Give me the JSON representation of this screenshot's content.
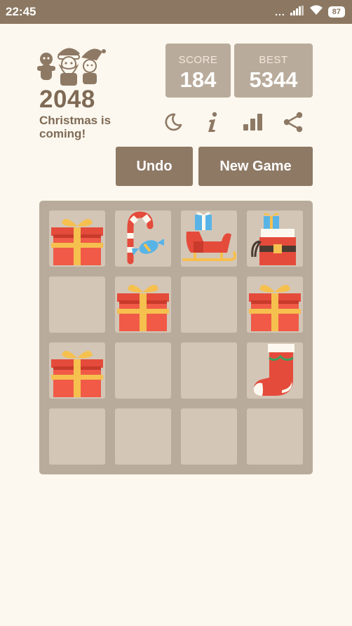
{
  "status_bar": {
    "time": "22:45",
    "dots": "...",
    "battery": "87",
    "icons": [
      "signal-icon",
      "wifi-icon",
      "battery-icon"
    ]
  },
  "header": {
    "title": "2048",
    "subtitle": "Christmas is coming!",
    "logo": "santa-elf-gingerbread-logo"
  },
  "scores": {
    "score_label": "SCORE",
    "score_value": "184",
    "best_label": "BEST",
    "best_value": "5344"
  },
  "toolbar_icons": [
    "moon-icon",
    "info-icon",
    "leaderboard-icon",
    "share-icon"
  ],
  "buttons": {
    "undo": "Undo",
    "new_game": "New Game"
  },
  "board": {
    "size": 4,
    "tiles": [
      [
        "gift-box",
        "candy-cane",
        "sleigh",
        "santa-sack"
      ],
      [
        "empty",
        "gift-box",
        "empty",
        "gift-box"
      ],
      [
        "gift-box",
        "empty",
        "empty",
        "stocking"
      ],
      [
        "empty",
        "empty",
        "empty",
        "empty"
      ]
    ]
  },
  "colors": {
    "background": "#fcf8ef",
    "status_bar": "#8c7862",
    "board": "#b9ab9b",
    "empty_cell": "#d3c6b7",
    "button": "#8e7965",
    "text_brown": "#7f6a55"
  }
}
